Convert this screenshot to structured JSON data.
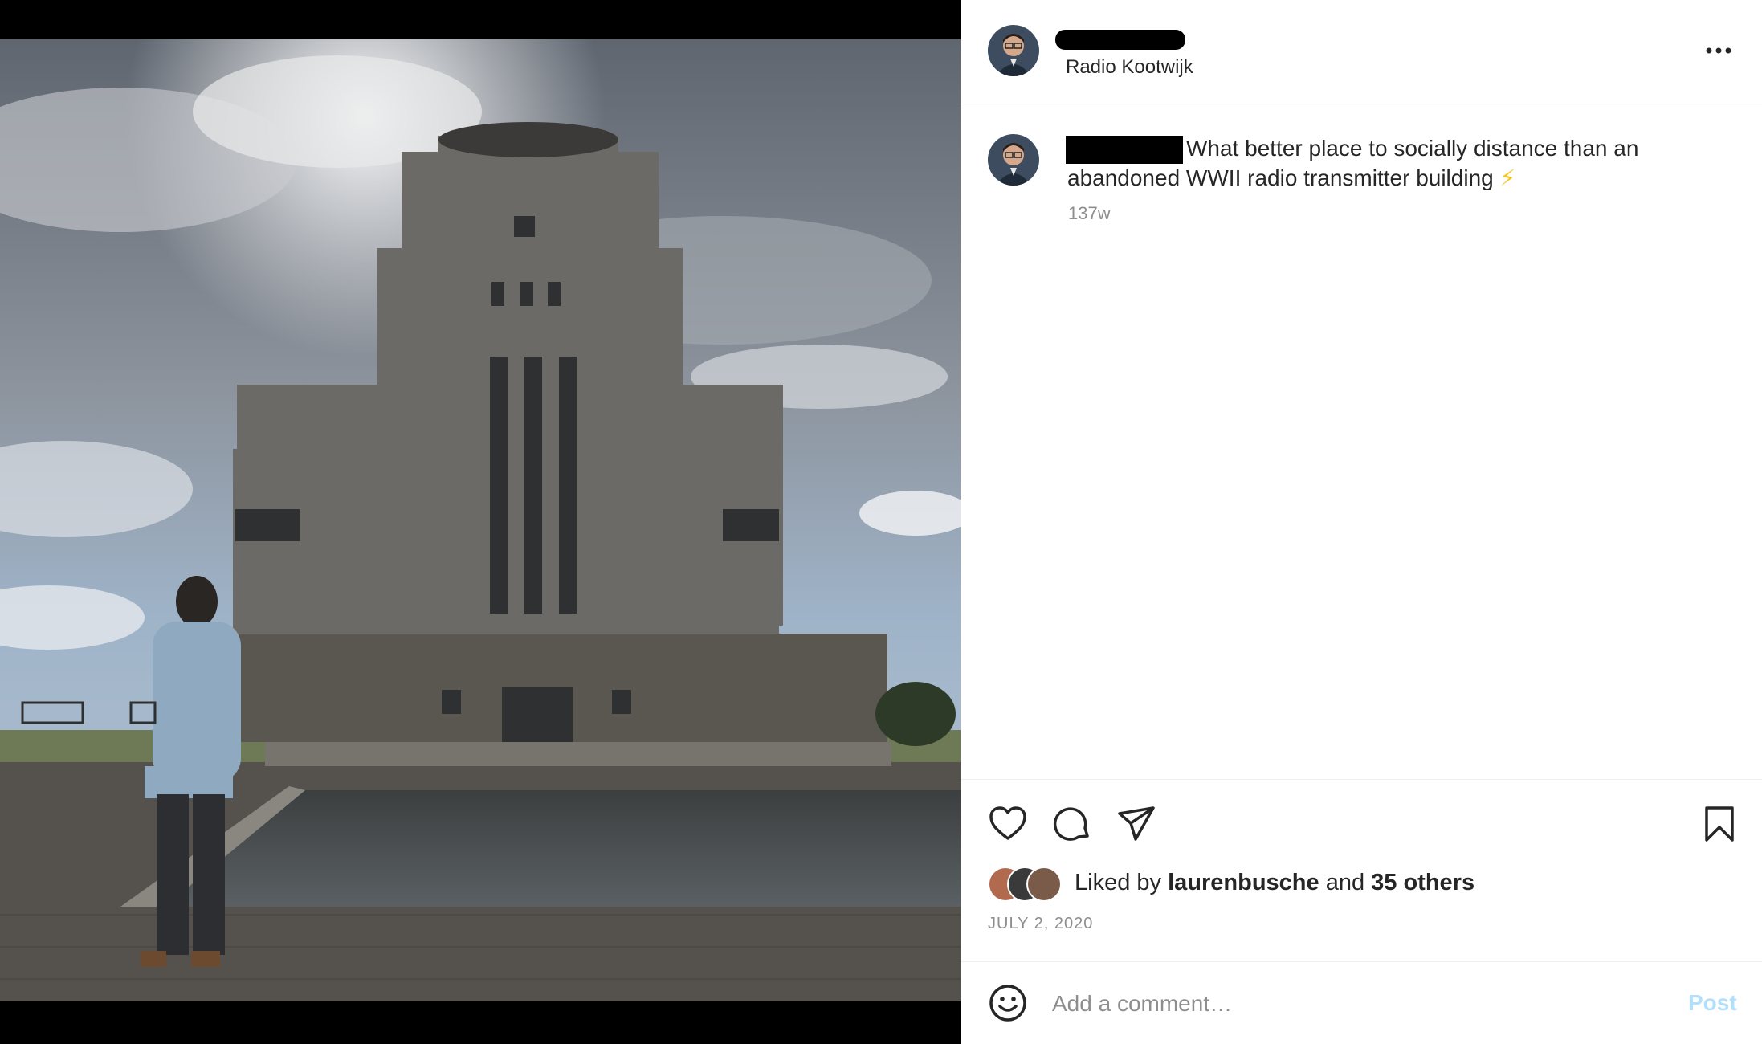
{
  "post": {
    "location": "Radio Kootwijk",
    "caption": "What better place to socially distance than an abandoned WWII radio transmitter building",
    "caption_emoji": "⚡",
    "time_ago": "137w",
    "likes": {
      "prefix": "Liked by ",
      "user": "laurenbusche",
      "middle": " and ",
      "others": "35 others"
    },
    "date": "JULY 2, 2020"
  },
  "comment_bar": {
    "placeholder": "Add a comment…",
    "post_label": "Post"
  },
  "icons": {
    "more": "more-options-icon",
    "like": "heart-icon",
    "comment": "comment-bubble-icon",
    "share": "paper-plane-icon",
    "save": "bookmark-icon",
    "emoji": "smiley-icon"
  },
  "colors": {
    "text": "#262626",
    "muted": "#8e8e8e",
    "post_button_disabled": "#b2dffc",
    "divider": "#efefef"
  }
}
